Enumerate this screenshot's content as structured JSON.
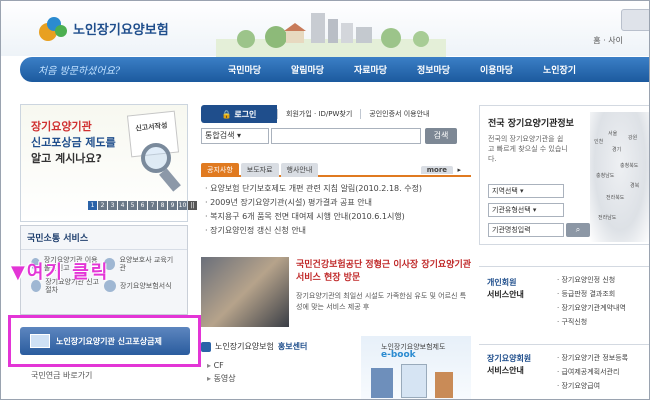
{
  "header": {
    "logo_text": "노인장기요양보험",
    "top_right": "홈 · 사이"
  },
  "nav": {
    "slogan": "처음 방문하셨어요?",
    "items": [
      "국민마당",
      "알림마당",
      "자료마당",
      "정보마당",
      "이용마당",
      "노인장기"
    ]
  },
  "banner": {
    "line1": "장기요양기관",
    "line2": "신고포상금 제도를",
    "line3": "알고 계시나요?",
    "doc_text": "신고서작성",
    "pager": [
      "1",
      "2",
      "3",
      "4",
      "5",
      "6",
      "7",
      "8",
      "9",
      "10"
    ]
  },
  "services": {
    "title": "국민소통 서비스",
    "items": [
      {
        "label": "장기요양기관 이용 불편신고",
        "icon": "building-icon"
      },
      {
        "label": "요양보호사 교육기관",
        "icon": "person-icon"
      },
      {
        "label": "장기요양기관 신고 절차",
        "icon": "document-icon"
      },
      {
        "label": "장기요양보험서식",
        "icon": "form-icon"
      }
    ]
  },
  "callout": "▼여기 클릭",
  "report_button": "노인장기요양기관 신고포상금제",
  "bottom_left": "국민연금 바로가기",
  "login": {
    "login_label": "로그인",
    "links": [
      "회원가입 · ID/PW찾기",
      "공인인증서 이용안내"
    ]
  },
  "search": {
    "select_value": "통합검색",
    "button": "검색"
  },
  "tabs": {
    "items": [
      "공지사항",
      "보도자료",
      "행사안내"
    ],
    "more": "more"
  },
  "notices": [
    "요양보험 단기보호제도 개편 관련 지침 알림(2010.2.18. 수정)",
    "2009년 장기요양기관(시설) 평가결과 공표 안내",
    "복지용구 6개 품목 전면 대여제 시행 안내(2010.6.1시행)",
    "장기요양인정 갱신 신청 안내"
  ],
  "news": {
    "headline": "국민건강보험공단 정형근 이사장 장기요양기관 서비스 현장 방문",
    "body": "장기요양기관의 최일선 시설도 가족한심 유도 및 어르신 특성에 맞는 서비스 제공 후"
  },
  "promo": {
    "title_prefix": "노인장기요양보험",
    "title_bold": "홍보센터",
    "items": [
      "CF",
      "동영상"
    ]
  },
  "ebook": {
    "sub": "노인장기요양보험제도",
    "title": "e-book"
  },
  "finder": {
    "title": "전국 장기요양기관정보",
    "desc": "전국의 장기요양기관을 쉽고 빠르게 찾으실 수 있습니다.",
    "select1": "지역선택",
    "select2": "기관유형선택",
    "input": "기관명칭입력",
    "map_labels": [
      "서울",
      "인천",
      "경기",
      "강원",
      "충청북도",
      "충청남도",
      "경북",
      "전라북도",
      "전라남도"
    ]
  },
  "individual": {
    "label_top": "개인회원",
    "label_bottom": "서비스안내",
    "links": [
      "장기요양인정 신청",
      "등급판정 결과조회",
      "장기요양기관계약내역",
      "구직신청"
    ]
  },
  "institution": {
    "label_top": "장기요양회원",
    "label_bottom": "서비스안내",
    "links": [
      "장기요양기관 정보등록",
      "급여제공계획서관리",
      "장기요양급여"
    ]
  }
}
